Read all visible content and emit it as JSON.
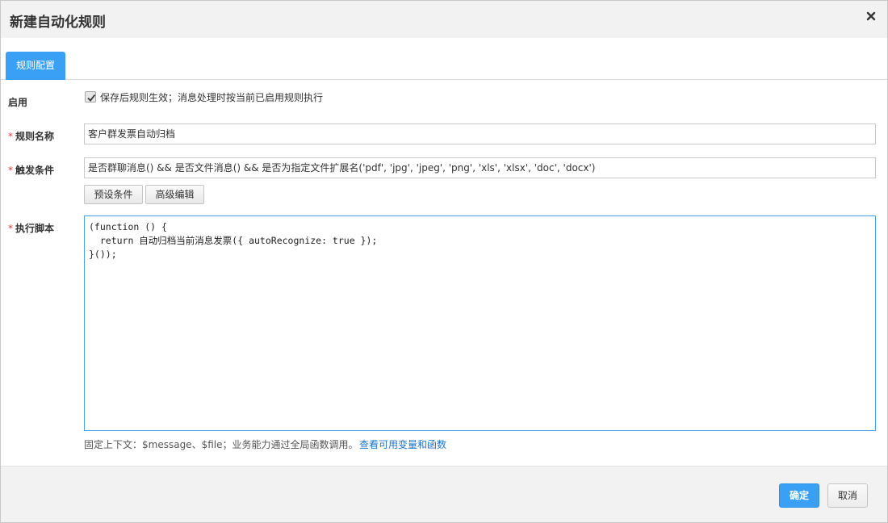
{
  "dialog": {
    "title": "新建自动化规则",
    "close_icon": "close-icon"
  },
  "tabs": [
    {
      "label": "规则配置",
      "active": true
    }
  ],
  "form": {
    "enable": {
      "label": "启用",
      "checked": true,
      "description": "保存后规则生效；消息处理时按当前已启用规则执行"
    },
    "rule_name": {
      "required_mark": "*",
      "label": "规则名称",
      "value": "客户群发票自动归档"
    },
    "trigger": {
      "required_mark": "*",
      "label": "触发条件",
      "value": "是否群聊消息() && 是否文件消息() && 是否为指定文件扩展名('pdf', 'jpg', 'jpeg', 'png', 'xls', 'xlsx', 'doc', 'docx')",
      "preset_button": "预设条件",
      "advanced_button": "高级编辑"
    },
    "script": {
      "required_mark": "*",
      "label": "执行脚本",
      "code": "(function () {\n  return 自动归档当前消息发票({ autoRecognize: true });\n}());",
      "hint": "固定上下文：$message、$file；业务能力通过全局函数调用。",
      "hint_link": "查看可用变量和函数"
    }
  },
  "footer": {
    "confirm_label": "确定",
    "cancel_label": "取消"
  },
  "colors": {
    "accent": "#3aa0f5",
    "required": "#e4393c",
    "link": "#1e73c8"
  }
}
